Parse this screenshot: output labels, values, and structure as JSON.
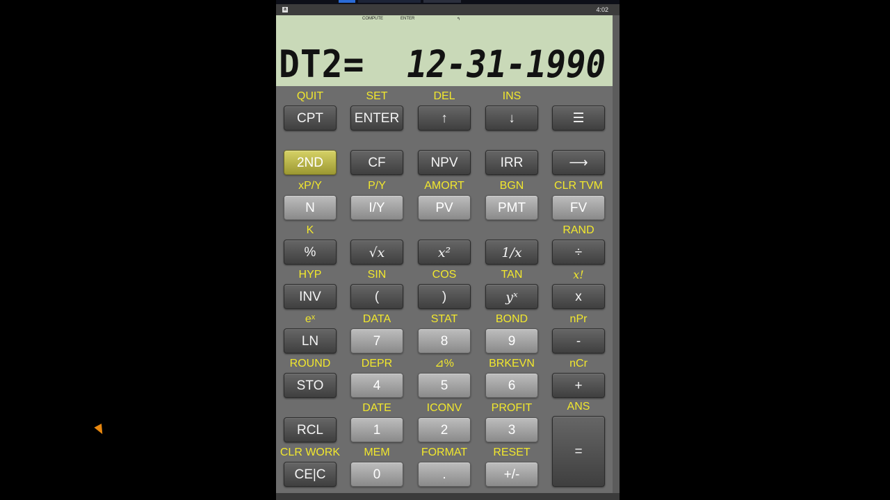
{
  "status": {
    "time": "4:02",
    "app_icon": "a"
  },
  "lcd": {
    "indicators": {
      "compute": "COMPUTE",
      "enter": "ENTER",
      "mark": "↰"
    },
    "label": "DT2=",
    "value": "12-31-1990"
  },
  "keys": {
    "cpt": {
      "label": "CPT",
      "second": "QUIT"
    },
    "enter": {
      "label": "ENTER",
      "second": "SET"
    },
    "up": {
      "label": "↑",
      "second": "DEL"
    },
    "down": {
      "label": "↓",
      "second": "INS"
    },
    "menu": {
      "label": "☰"
    },
    "second_fn": {
      "label": "2ND"
    },
    "cf": {
      "label": "CF"
    },
    "npv": {
      "label": "NPV"
    },
    "irr": {
      "label": "IRR"
    },
    "right": {
      "label": "⟶"
    },
    "n": {
      "label": "N",
      "second": "xP/Y"
    },
    "iy": {
      "label": "I/Y",
      "second": "P/Y"
    },
    "pv": {
      "label": "PV",
      "second": "AMORT"
    },
    "pmt": {
      "label": "PMT",
      "second": "BGN"
    },
    "fv": {
      "label": "FV",
      "second": "CLR TVM"
    },
    "pct": {
      "label": "%",
      "second": "K"
    },
    "sqrt": {
      "label": "√x"
    },
    "sq": {
      "label": "x²"
    },
    "recip": {
      "label": "1/x"
    },
    "div": {
      "label": "÷",
      "second": "RAND"
    },
    "inv": {
      "label": "INV",
      "second": "HYP"
    },
    "lparen": {
      "label": "(",
      "second": "SIN"
    },
    "rparen": {
      "label": ")",
      "second": "COS"
    },
    "yx": {
      "label": "yˣ",
      "second": "TAN"
    },
    "mul": {
      "label": "x",
      "second": "x!"
    },
    "ln": {
      "label": "LN",
      "second": "eˣ"
    },
    "k7": {
      "label": "7",
      "second": "DATA"
    },
    "k8": {
      "label": "8",
      "second": "STAT"
    },
    "k9": {
      "label": "9",
      "second": "BOND"
    },
    "minus": {
      "label": "-",
      "second": "nPr"
    },
    "sto": {
      "label": "STO",
      "second": "ROUND"
    },
    "k4": {
      "label": "4",
      "second": "DEPR"
    },
    "k5": {
      "label": "5",
      "second": "⊿%"
    },
    "k6": {
      "label": "6",
      "second": "BRKEVN"
    },
    "plus": {
      "label": "+",
      "second": "nCr"
    },
    "rcl": {
      "label": "RCL"
    },
    "k1": {
      "label": "1",
      "second": "DATE"
    },
    "k2": {
      "label": "2",
      "second": "ICONV"
    },
    "k3": {
      "label": "3",
      "second": "PROFIT"
    },
    "equals": {
      "label": "=",
      "second": "ANS"
    },
    "cec": {
      "label": "CE|C",
      "second": "CLR WORK"
    },
    "k0": {
      "label": "0",
      "second": "MEM"
    },
    "dot": {
      "label": ".",
      "second": "FORMAT"
    },
    "sign": {
      "label": "+/-",
      "second": "RESET"
    }
  },
  "colors": {
    "secondary_text": "#f2e82d",
    "lcd_bg": "#c9d9b8",
    "gold_key": "#c9c556"
  }
}
